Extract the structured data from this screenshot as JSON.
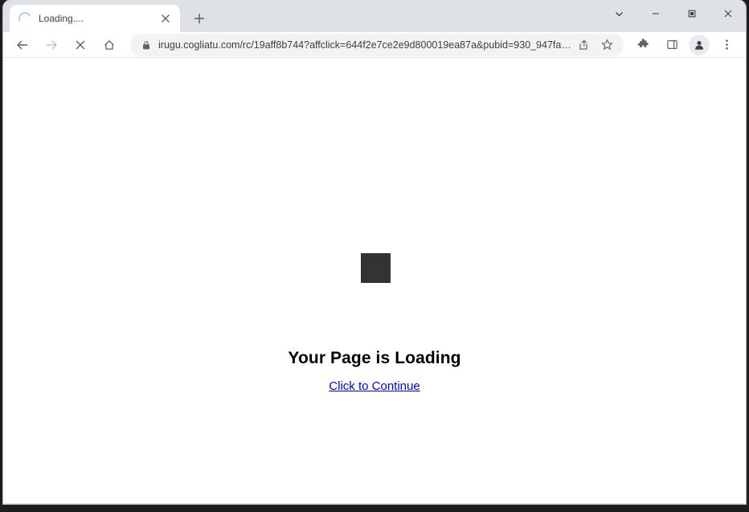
{
  "window": {
    "controls": {
      "tab_search": "tab-search",
      "minimize": "minimize",
      "maximize": "maximize",
      "close": "close"
    }
  },
  "tab_strip": {
    "tabs": [
      {
        "title": "Loading....",
        "favicon": "loading-spinner",
        "close_label": "close-tab"
      }
    ],
    "new_tab_label": "new-tab"
  },
  "toolbar": {
    "back_label": "back",
    "forward_label": "forward",
    "stop_label": "stop",
    "home_label": "home",
    "security_icon": "lock-icon",
    "url": "irugu.cogliatu.com/rc/19aff8b744?affclick=644f2e7ce2e9d800019ea87a&pubid=930_947fa8f5_f0cea",
    "share_label": "share",
    "bookmark_label": "bookmark",
    "extensions_label": "extensions",
    "side_panel_label": "side-panel",
    "profile_label": "profile",
    "menu_label": "chrome-menu"
  },
  "page": {
    "heading": "Your Page is Loading",
    "link_text": "Click to Continue",
    "placeholder_color": "#333333",
    "link_color": "#0000ee"
  }
}
